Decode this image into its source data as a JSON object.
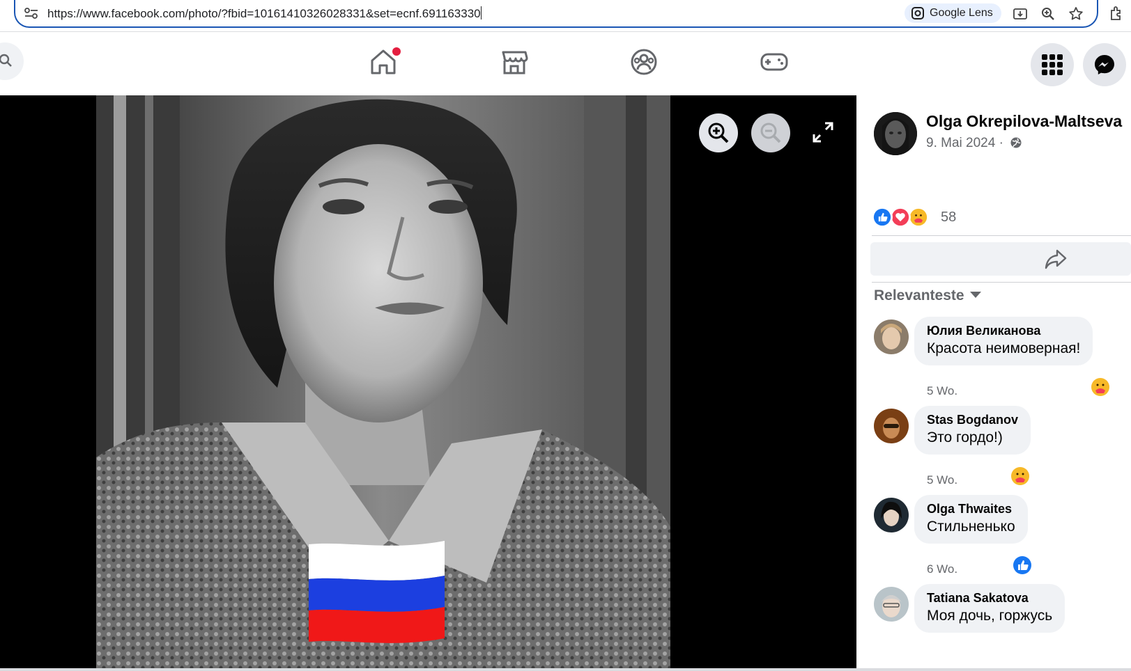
{
  "browser": {
    "url": "https://www.facebook.com/photo/?fbid=10161410326028331&set=ecnf.691163330",
    "lens_label": "Google Lens"
  },
  "nav": {
    "items": [
      "home-icon",
      "marketplace-icon",
      "groups-icon",
      "gaming-icon"
    ],
    "home_notification": true
  },
  "photo": {
    "flag_colors": [
      "#ffffff",
      "#1c3fe0",
      "#f01818"
    ]
  },
  "post": {
    "author": "Olga Okrepilova-Maltseva",
    "date": "9. Mai 2024 ·",
    "reaction_count": "58",
    "sort_label": "Relevanteste"
  },
  "comments": [
    {
      "name": "Юлия Великанова",
      "text": "Красота неимоверная!",
      "time": "5 Wo.",
      "reaction": "care-icon"
    },
    {
      "name": "Stas Bogdanov",
      "text": "Это гордо!)",
      "time": "5 Wo.",
      "reaction": "care-icon"
    },
    {
      "name": "Olga Thwaites",
      "text": "Стильненько",
      "time": "6 Wo.",
      "reaction": "like-icon"
    },
    {
      "name": "Tatiana Sakatova",
      "text": "Моя дочь, горжусь",
      "time": "",
      "reaction": ""
    }
  ],
  "colors": {
    "fb_blue": "#1877f2",
    "love_red": "#f33e58",
    "care_yellow": "#f7b928",
    "url_border": "#1a56b4"
  }
}
